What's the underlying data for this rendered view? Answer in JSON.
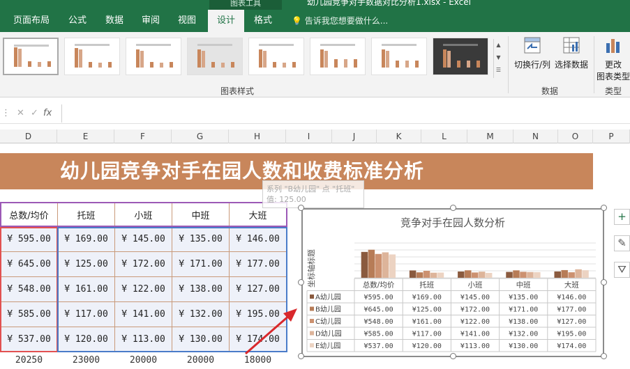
{
  "window": {
    "context_tab": "图表工具",
    "title": "幼儿园竞争对手数据对比分析1.xlsx - Excel"
  },
  "tabs": [
    {
      "label": "页面布局"
    },
    {
      "label": "公式"
    },
    {
      "label": "数据"
    },
    {
      "label": "审阅"
    },
    {
      "label": "视图"
    },
    {
      "label": "设计"
    },
    {
      "label": "格式"
    }
  ],
  "tell_me": "告诉我您想要做什么...",
  "ribbon": {
    "style_group_label": "图表样式",
    "data_group_label": "数据",
    "type_group_label": "类型",
    "switch_row_col": "切换行/列",
    "select_data": "选择数据",
    "change_type_line1": "更改",
    "change_type_line2": "图表类型"
  },
  "formula_bar": {
    "cancel_icon": "✕",
    "confirm_icon": "✓",
    "fx_icon": "fx"
  },
  "columns": [
    "D",
    "E",
    "F",
    "G",
    "H",
    "I",
    "J",
    "K",
    "L",
    "M",
    "N",
    "O",
    "P"
  ],
  "sheet": {
    "banner": "幼儿园竞争对手在园人数和收费标准分析",
    "tooltip_line1": "系列 \"B幼儿园\" 点 \"托班\"",
    "tooltip_line2": "值: 125.00",
    "table_header": [
      "总数/均价",
      "托班",
      "小班",
      "中班",
      "大班"
    ],
    "table_rows": [
      [
        "¥ 595.00",
        "¥ 169.00",
        "¥ 145.00",
        "¥ 135.00",
        "¥ 146.00"
      ],
      [
        "¥ 645.00",
        "¥ 125.00",
        "¥ 172.00",
        "¥ 171.00",
        "¥ 177.00"
      ],
      [
        "¥ 548.00",
        "¥ 161.00",
        "¥ 122.00",
        "¥ 138.00",
        "¥ 127.00"
      ],
      [
        "¥ 585.00",
        "¥ 117.00",
        "¥ 141.00",
        "¥ 132.00",
        "¥ 195.00"
      ],
      [
        "¥ 537.00",
        "¥ 120.00",
        "¥ 113.00",
        "¥ 130.00",
        "¥ 174.00"
      ]
    ],
    "table_footer": [
      "20250",
      "23000",
      "20000",
      "20000",
      "18000"
    ]
  },
  "chart_data": {
    "type": "bar",
    "title": "竞争对手在园人数分析",
    "ylabel": "坐标轴标题",
    "categories": [
      "总数/均价",
      "托班",
      "小班",
      "中班",
      "大班"
    ],
    "ylim": [
      0,
      800
    ],
    "series": [
      {
        "name": "A幼儿园",
        "color": "#8a5a3e",
        "values": [
          595,
          169,
          145,
          135,
          146
        ],
        "labels": [
          "¥595.00",
          "¥169.00",
          "¥145.00",
          "¥135.00",
          "¥146.00"
        ]
      },
      {
        "name": "B幼儿园",
        "color": "#b77c57",
        "values": [
          645,
          125,
          172,
          171,
          177
        ],
        "labels": [
          "¥645.00",
          "¥125.00",
          "¥172.00",
          "¥171.00",
          "¥177.00"
        ]
      },
      {
        "name": "C幼儿园",
        "color": "#cc9170",
        "values": [
          548,
          161,
          122,
          138,
          127
        ],
        "labels": [
          "¥548.00",
          "¥161.00",
          "¥122.00",
          "¥138.00",
          "¥127.00"
        ]
      },
      {
        "name": "D幼儿园",
        "color": "#ddb49a",
        "values": [
          585,
          117,
          141,
          132,
          195
        ],
        "labels": [
          "¥585.00",
          "¥117.00",
          "¥141.00",
          "¥132.00",
          "¥195.00"
        ]
      },
      {
        "name": "E幼儿园",
        "color": "#ecd3c2",
        "values": [
          537,
          120,
          113,
          130,
          174
        ],
        "labels": [
          "¥537.00",
          "¥120.00",
          "¥113.00",
          "¥130.00",
          "¥174.00"
        ]
      }
    ],
    "grid": true,
    "legend": "data-table"
  },
  "side_buttons": {
    "add": "+",
    "style": "✎",
    "filter": "⛛"
  }
}
